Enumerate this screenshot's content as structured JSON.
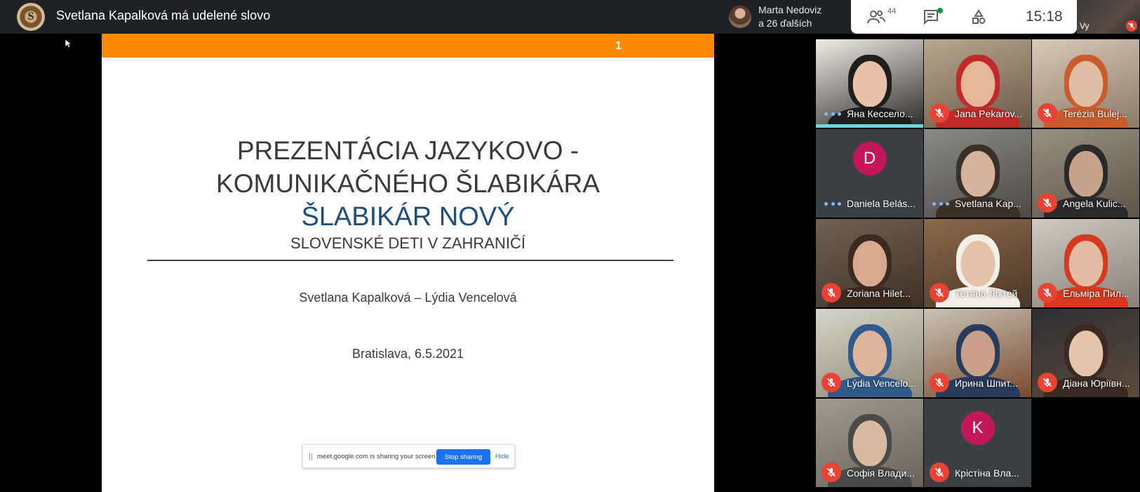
{
  "header": {
    "speaker_title": "Svetlana Kapalková má udelené slovo",
    "logo_letter": "S"
  },
  "presenter": {
    "name": "Marta Nedoviz",
    "others": "a 26 ďalších"
  },
  "controls": {
    "people_count": "44",
    "clock": "15:18"
  },
  "self_view": {
    "label": "Vy"
  },
  "slide": {
    "page_number": "1",
    "title_line_1": "PREZENTÁCIA JAZYKOVO -",
    "title_line_2": "KOMUNIKAČNÉHO ŠLABIKÁRA",
    "title_line_3": "ŠLABIKÁR NOVÝ",
    "title_line_4": "SLOVENSKÉ DETI V ZAHRANIČÍ",
    "authors": "Svetlana Kapalková – Lýdia Vencelová",
    "place_date": "Bratislava, 6.5.2021"
  },
  "share_bar": {
    "message": "meet.google.com is sharing your screen.",
    "stop_label": "Stop sharing",
    "hide_label": "Hide"
  },
  "participants": [
    {
      "name": "Яна Кессело...",
      "state": "speaking"
    },
    {
      "name": "Jana Pekarov...",
      "state": "muted"
    },
    {
      "name": "Terézia Bulej...",
      "state": "muted"
    },
    {
      "name": "Daniela Belás...",
      "state": "active",
      "avatar_letter": "D",
      "avatar_color": "#c2185b"
    },
    {
      "name": "Svetlana Kap...",
      "state": "active"
    },
    {
      "name": "Angela Kulic...",
      "state": "muted"
    },
    {
      "name": "Zoriana Hilet...",
      "state": "muted"
    },
    {
      "name": "Тетяна Ліхтей",
      "state": "muted"
    },
    {
      "name": "Ельміра Пил...",
      "state": "muted"
    },
    {
      "name": "Lýdia Vencelo...",
      "state": "muted"
    },
    {
      "name": "Ирина Шпит...",
      "state": "muted"
    },
    {
      "name": "Діана Юріївн...",
      "state": "muted"
    },
    {
      "name": "Софія Влади...",
      "state": "muted"
    },
    {
      "name": "Крістіна Вла...",
      "state": "muted",
      "avatar_letter": "K",
      "avatar_color": "#c2185b"
    }
  ],
  "colors": {
    "slide_accent": "#ff8a00",
    "slide_title_blue": "#1f4e79",
    "mute_red": "#ea4335",
    "speaking_teal": "#6fd5d9"
  }
}
